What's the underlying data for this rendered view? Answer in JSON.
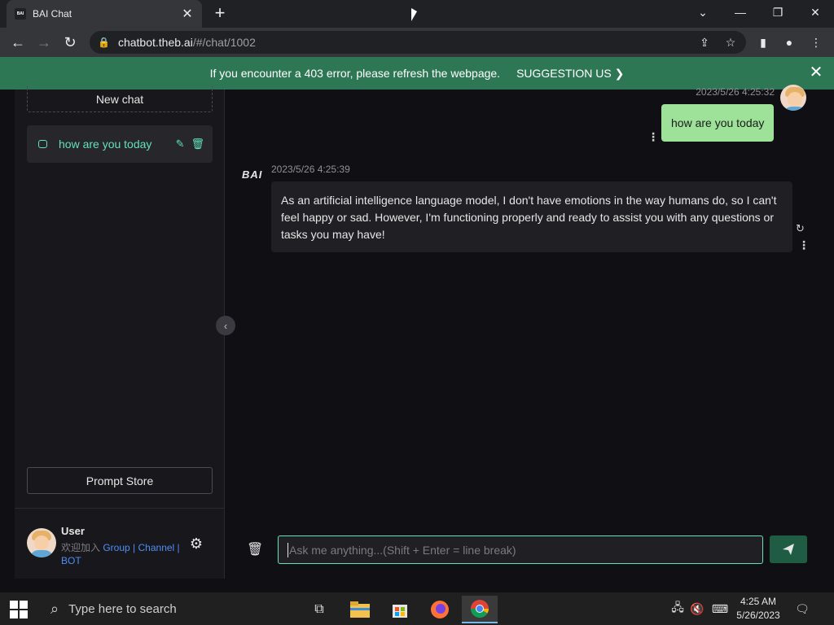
{
  "browser": {
    "tab_title": "BAI Chat",
    "favicon_text": "BAI",
    "url_host": "chatbot.theb.ai",
    "url_path": "/#/chat/1002"
  },
  "banner": {
    "message": "If you encounter a 403 error, please refresh the webpage.",
    "suggestion": "SUGGESTION US ❯"
  },
  "sidebar": {
    "new_chat": "New chat",
    "history": [
      {
        "title": "how are you today"
      }
    ],
    "prompt_store": "Prompt Store",
    "user": {
      "name": "User",
      "join_text": "欢迎加入 ",
      "link_group": "Group",
      "sep1": " | ",
      "link_channel": "Channel",
      "sep2": " | ",
      "link_bot": "BOT"
    }
  },
  "chat": {
    "user_message": {
      "time": "2023/5/26 4:25:32",
      "text": "how are you today"
    },
    "bot_message": {
      "logo": "BAI",
      "time": "2023/5/26 4:25:39",
      "text": "As an artificial intelligence language model, I don't have emotions in the way humans do, so I can't feel happy or sad. However, I'm functioning properly and ready to assist you with any questions or tasks you may have!"
    },
    "input_placeholder": "Ask me anything...(Shift + Enter = line break)"
  },
  "taskbar": {
    "search_placeholder": "Type here to search",
    "time": "4:25 AM",
    "date": "5/26/2023"
  },
  "colors": {
    "accent": "#63e2b7",
    "banner": "#2e7755",
    "user_bubble": "#9ee29a"
  }
}
